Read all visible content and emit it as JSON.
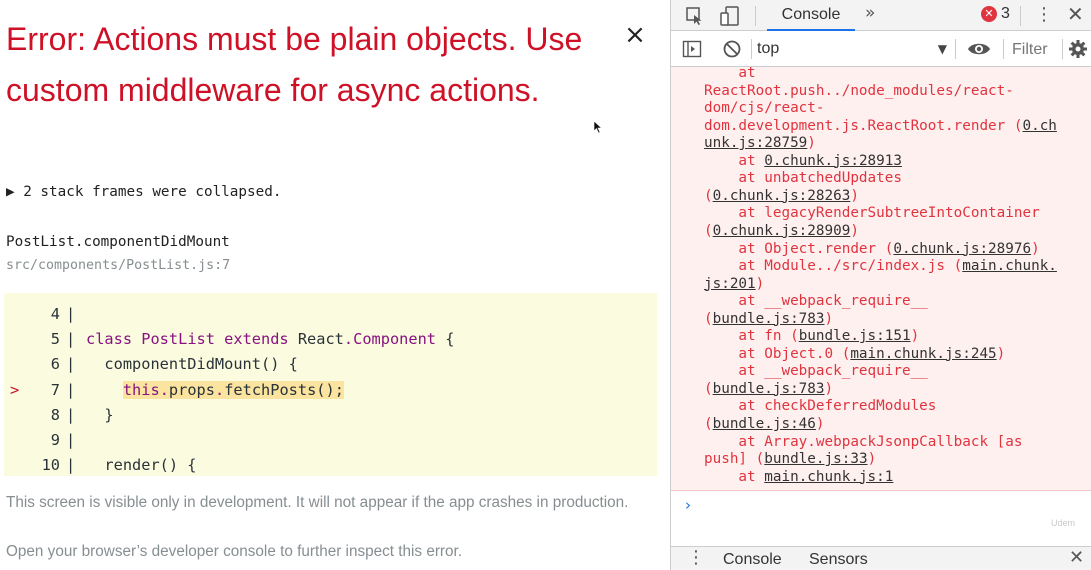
{
  "overlay": {
    "error_title": "Error: Actions must be plain objects. Use custom middleware for async actions.",
    "close_label": "×",
    "collapsed_frames": "▶ 2 stack frames were collapsed.",
    "frame": {
      "function": "PostList.componentDidMount",
      "location": "src/components/PostList.js:7"
    },
    "code": {
      "lines": [
        {
          "marker": "",
          "number": "4",
          "tokens": []
        },
        {
          "marker": "",
          "number": "5",
          "tokens": [
            {
              "t": "class ",
              "c": "kw"
            },
            {
              "t": "PostList ",
              "c": "cls"
            },
            {
              "t": "extends ",
              "c": "kw"
            },
            {
              "t": "React",
              "c": ""
            },
            {
              "t": ".",
              "c": "kw"
            },
            {
              "t": "Component",
              "c": "cls"
            },
            {
              "t": " {",
              "c": ""
            }
          ]
        },
        {
          "marker": "",
          "number": "6",
          "tokens": [
            {
              "t": "  componentDidMount() {",
              "c": ""
            }
          ]
        },
        {
          "marker": ">",
          "number": "7",
          "highlight": true,
          "tokens": [
            {
              "t": "    ",
              "c": "pad"
            },
            {
              "t": "this",
              "c": "kw"
            },
            {
              "t": ".",
              "c": "kw"
            },
            {
              "t": "props",
              "c": ""
            },
            {
              "t": ".",
              "c": "kw"
            },
            {
              "t": "fetchPosts();",
              "c": ""
            }
          ]
        },
        {
          "marker": "",
          "number": "8",
          "tokens": [
            {
              "t": "  }",
              "c": ""
            }
          ]
        },
        {
          "marker": "",
          "number": "9",
          "tokens": []
        },
        {
          "marker": "",
          "number": "10",
          "tokens": [
            {
              "t": "  render() {",
              "c": ""
            }
          ]
        }
      ]
    },
    "footer_line1": "This screen is visible only in development. It will not appear if the app crashes in production.",
    "footer_line2": "Open your browser’s developer console to further inspect this error."
  },
  "devtools": {
    "tabs": {
      "active": "Console",
      "more": "»",
      "error_count": "3"
    },
    "toolbar": {
      "context": "top",
      "caret": "▼",
      "filter_placeholder": "Filter"
    },
    "console_lines": [
      {
        "text": "    at"
      },
      {
        "text": "ReactRoot.push../node_modules/react-"
      },
      {
        "text": "dom/cjs/react-"
      },
      {
        "text": "dom.development.js.ReactRoot.render (",
        "link": "0.ch"
      },
      {
        "text": "",
        "link": "unk.js:28759",
        "after": ")"
      },
      {
        "text": "    at ",
        "link": "0.chunk.js:28913"
      },
      {
        "text": "    at unbatchedUpdates"
      },
      {
        "text": "(",
        "link": "0.chunk.js:28263",
        "after": ")"
      },
      {
        "text": "    at legacyRenderSubtreeIntoContainer"
      },
      {
        "text": "(",
        "link": "0.chunk.js:28909",
        "after": ")"
      },
      {
        "text": "    at Object.render (",
        "link": "0.chunk.js:28976",
        "after": ")"
      },
      {
        "text": "    at Module../src/index.js (",
        "link": "main.chunk."
      },
      {
        "text": "",
        "link": "js:201",
        "after": ")"
      },
      {
        "text": "    at __webpack_require__"
      },
      {
        "text": "(",
        "link": "bundle.js:783",
        "after": ")"
      },
      {
        "text": "    at fn (",
        "link": "bundle.js:151",
        "after": ")"
      },
      {
        "text": "    at Object.0 (",
        "link": "main.chunk.js:245",
        "after": ")"
      },
      {
        "text": "    at __webpack_require__"
      },
      {
        "text": "(",
        "link": "bundle.js:783",
        "after": ")"
      },
      {
        "text": "    at checkDeferredModules"
      },
      {
        "text": "(",
        "link": "bundle.js:46",
        "after": ")"
      },
      {
        "text": "    at Array.webpackJsonpCallback [as"
      },
      {
        "text": "push] (",
        "link": "bundle.js:33",
        "after": ")"
      },
      {
        "text": "    at ",
        "link": "main.chunk.js:1"
      }
    ],
    "prompt": "›",
    "watermark": "Udem",
    "drawer": {
      "tab1": "Console",
      "tab2": "Sensors"
    }
  },
  "colors": {
    "error_red": "#ce1126",
    "console_red": "#e0343f",
    "accent_blue": "#1a73e8",
    "code_bg": "#fbfbe0"
  }
}
